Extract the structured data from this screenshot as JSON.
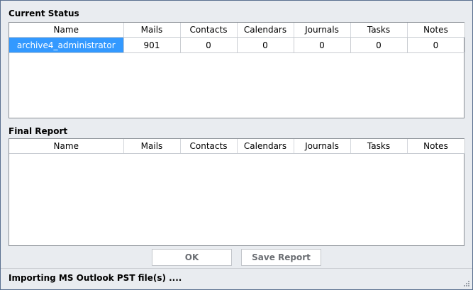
{
  "current_status": {
    "title": "Current Status",
    "columns": [
      "Name",
      "Mails",
      "Contacts",
      "Calendars",
      "Journals",
      "Tasks",
      "Notes"
    ],
    "rows": [
      [
        "archive4_administrator",
        "901",
        "0",
        "0",
        "0",
        "0",
        "0"
      ]
    ]
  },
  "final_report": {
    "title": "Final Report",
    "columns": [
      "Name",
      "Mails",
      "Contacts",
      "Calendars",
      "Journals",
      "Tasks",
      "Notes"
    ],
    "rows": []
  },
  "buttons": {
    "ok_label": "OK",
    "save_label": "Save Report"
  },
  "status_bar": {
    "text": "Importing MS Outlook PST file(s) ...."
  }
}
